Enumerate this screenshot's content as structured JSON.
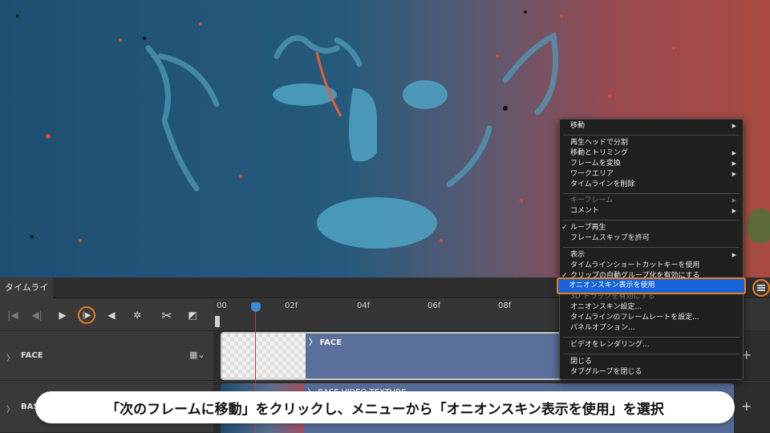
{
  "timeline": {
    "tab_label": "タイムライン",
    "panel_menu_icon": "hamburger-icon",
    "ruler_ticks": [
      "00",
      "02f",
      "04f",
      "06f",
      "08f"
    ],
    "tracks": [
      {
        "name": "FACE",
        "clip_label": "FACE"
      },
      {
        "name": "BASE VIDEO TEXTURE",
        "visible_name": "BASE",
        "clip_label": "BASE VIDEO TEXTURE"
      }
    ],
    "controls": [
      "first-frame-icon",
      "prev-frame-icon",
      "play-icon",
      "next-frame-icon",
      "audio-icon",
      "settings-icon",
      "scissors-icon",
      "transition-icon"
    ]
  },
  "context_menu": {
    "items": [
      {
        "label": "移動",
        "submenu": true
      },
      {
        "label": "再生ヘッドで分割"
      },
      {
        "label": "移動とトリミング",
        "submenu": true
      },
      {
        "label": "フレームを変換",
        "submenu": true
      },
      {
        "label": "ワークエリア",
        "submenu": true
      },
      {
        "label": "タイムラインを削除"
      },
      {
        "label": "キーフレーム",
        "submenu": true,
        "disabled": true
      },
      {
        "label": "コメント",
        "submenu": true
      },
      {
        "label": "ループ再生",
        "checked": true
      },
      {
        "label": "フレームスキップを許可"
      },
      {
        "label": "表示",
        "submenu": true
      },
      {
        "label": "タイムラインショートカットキーを使用"
      },
      {
        "label": "クリップの自動グループ化を有効にする",
        "checked": true
      },
      {
        "label": "オニオンスキン表示を使用",
        "highlighted": true
      },
      {
        "label": "3D トラックを有効にする",
        "disabled": true
      },
      {
        "label": "オニオンスキン設定..."
      },
      {
        "label": "タイムラインのフレームレートを設定..."
      },
      {
        "label": "パネルオプション..."
      },
      {
        "label": "ビデオをレンダリング..."
      },
      {
        "label": "閉じる"
      },
      {
        "label": "タブグループを閉じる"
      }
    ]
  },
  "caption": "「次のフレームに移動」をクリックし、メニューから「オニオンスキン表示を使用」を選択",
  "colors": {
    "accent": "#f07d1a",
    "selection": "#1565d8",
    "playhead": "#e03030",
    "clip": "#5a6f9a"
  }
}
